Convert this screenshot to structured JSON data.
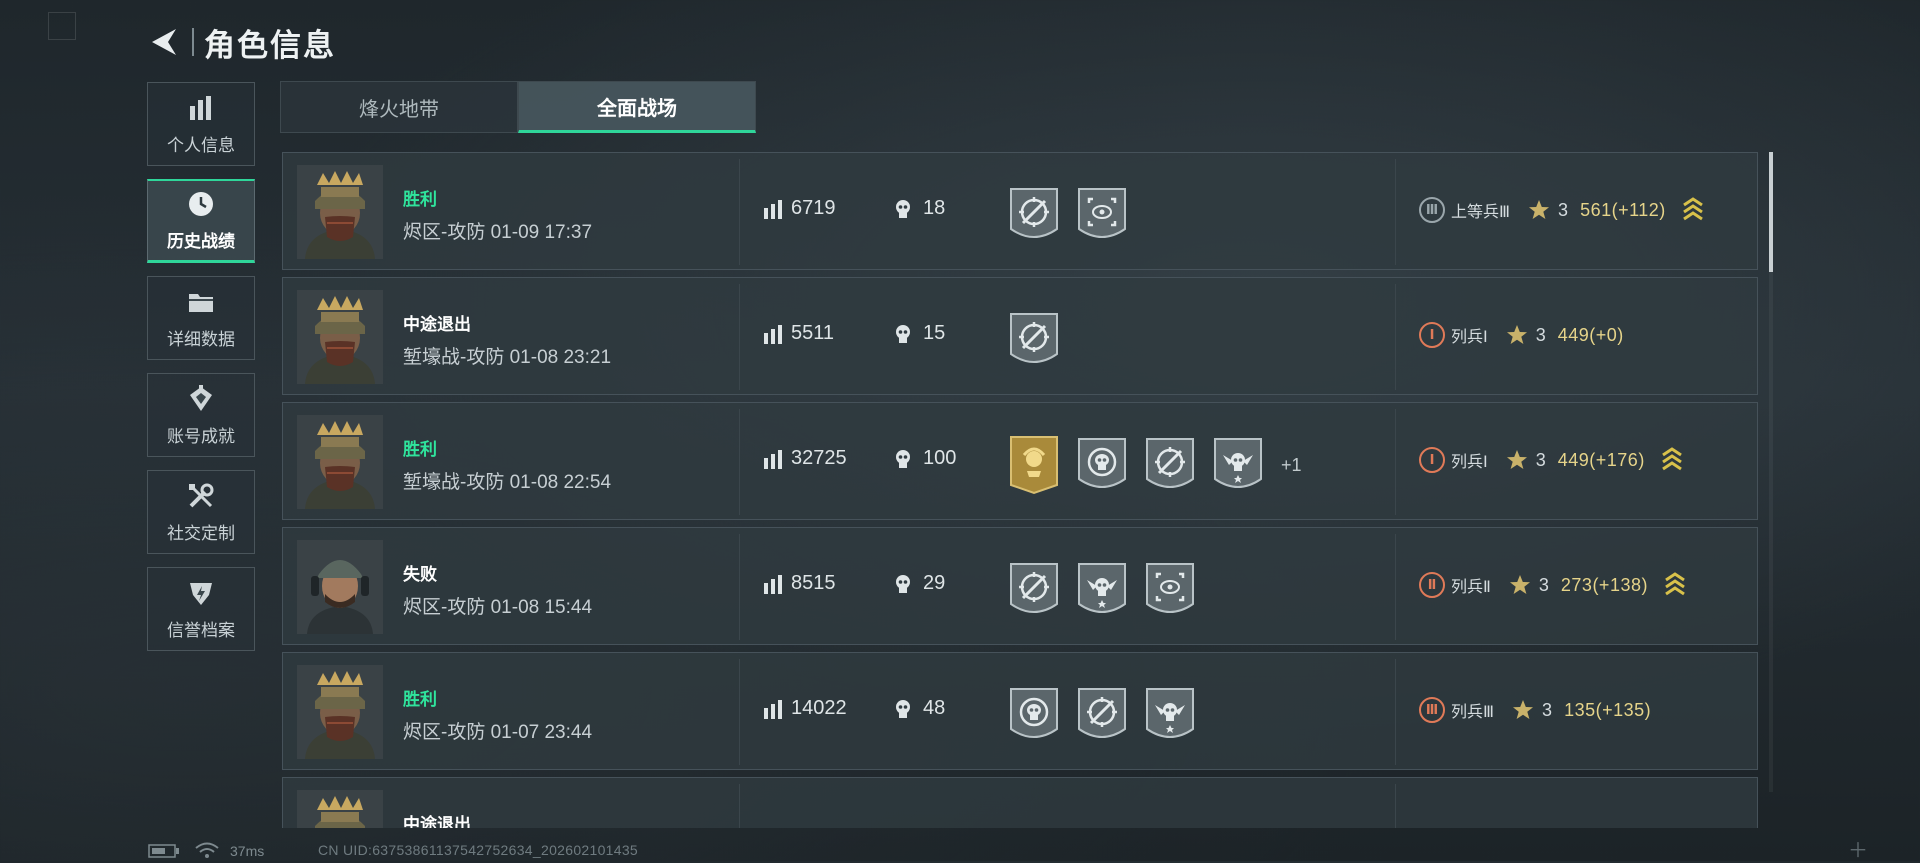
{
  "header": {
    "title": "角色信息"
  },
  "sidebar": {
    "items": [
      {
        "label": "个人信息",
        "icon": "bar-chart-icon",
        "active": false
      },
      {
        "label": "历史战绩",
        "icon": "clock-icon",
        "active": true
      },
      {
        "label": "详细数据",
        "icon": "folder-icon",
        "active": false
      },
      {
        "label": "账号成就",
        "icon": "achievement-icon",
        "active": false
      },
      {
        "label": "社交定制",
        "icon": "tools-icon",
        "active": false
      },
      {
        "label": "信誉档案",
        "icon": "shield-icon",
        "active": false
      }
    ]
  },
  "tabs": [
    {
      "label": "烽火地带",
      "active": false
    },
    {
      "label": "全面战场",
      "active": true
    }
  ],
  "matches": [
    {
      "result": "胜利",
      "win": true,
      "mode": "烬区-攻防 01-09 17:37",
      "score": "6719",
      "kills": "18",
      "badges": [
        "crossed-rifle-shield-icon",
        "recon-eye-shield-icon"
      ],
      "more": "",
      "rank_numeral": "Ⅲ",
      "rank_name": "上等兵Ⅲ",
      "rank_color": "#9aa6ab",
      "level": "3",
      "points": "561(+112)",
      "promoted": true
    },
    {
      "result": "中途退出",
      "win": false,
      "mode": "堑壕战-攻防 01-08 23:21",
      "score": "5511",
      "kills": "15",
      "badges": [
        "crossed-rifle-shield-icon"
      ],
      "more": "",
      "rank_numeral": "Ⅰ",
      "rank_name": "列兵Ⅰ",
      "rank_color": "#e07a58",
      "level": "3",
      "points": "449(+0)",
      "promoted": false
    },
    {
      "result": "胜利",
      "win": true,
      "mode": "堑壕战-攻防 01-08 22:54",
      "score": "32725",
      "kills": "100",
      "badges": [
        "gold-mvp-banner-icon",
        "skull-target-shield-icon",
        "crossed-rifle-shield-icon",
        "winged-skull-shield-icon"
      ],
      "more": "+1",
      "rank_numeral": "Ⅰ",
      "rank_name": "列兵Ⅰ",
      "rank_color": "#e07a58",
      "level": "3",
      "points": "449(+176)",
      "promoted": true
    },
    {
      "result": "失败",
      "win": false,
      "mode": "烬区-攻防 01-08 15:44",
      "score": "8515",
      "kills": "29",
      "badges": [
        "crossed-rifle-shield-icon",
        "winged-skull-shield-icon",
        "recon-eye-shield-icon"
      ],
      "more": "",
      "rank_numeral": "Ⅱ",
      "rank_name": "列兵Ⅱ",
      "rank_color": "#e07a58",
      "level": "3",
      "points": "273(+138)",
      "promoted": true
    },
    {
      "result": "胜利",
      "win": true,
      "mode": "烬区-攻防 01-07 23:44",
      "score": "14022",
      "kills": "48",
      "badges": [
        "skull-target-shield-icon",
        "crossed-rifle-shield-icon",
        "winged-skull-shield-icon"
      ],
      "more": "",
      "rank_numeral": "Ⅲ",
      "rank_name": "列兵Ⅲ",
      "rank_color": "#e07a58",
      "level": "3",
      "points": "135(+135)",
      "promoted": false
    },
    {
      "result": "中途退出",
      "win": false,
      "mode": "",
      "score": "",
      "kills": "",
      "badges": [],
      "more": "",
      "rank_numeral": "",
      "rank_name": "",
      "rank_color": "#e07a58",
      "level": "",
      "points": "",
      "promoted": false
    }
  ],
  "footer": {
    "ping": "37ms",
    "uid": "CN UID:6375386113754275263​4_202602101435"
  }
}
